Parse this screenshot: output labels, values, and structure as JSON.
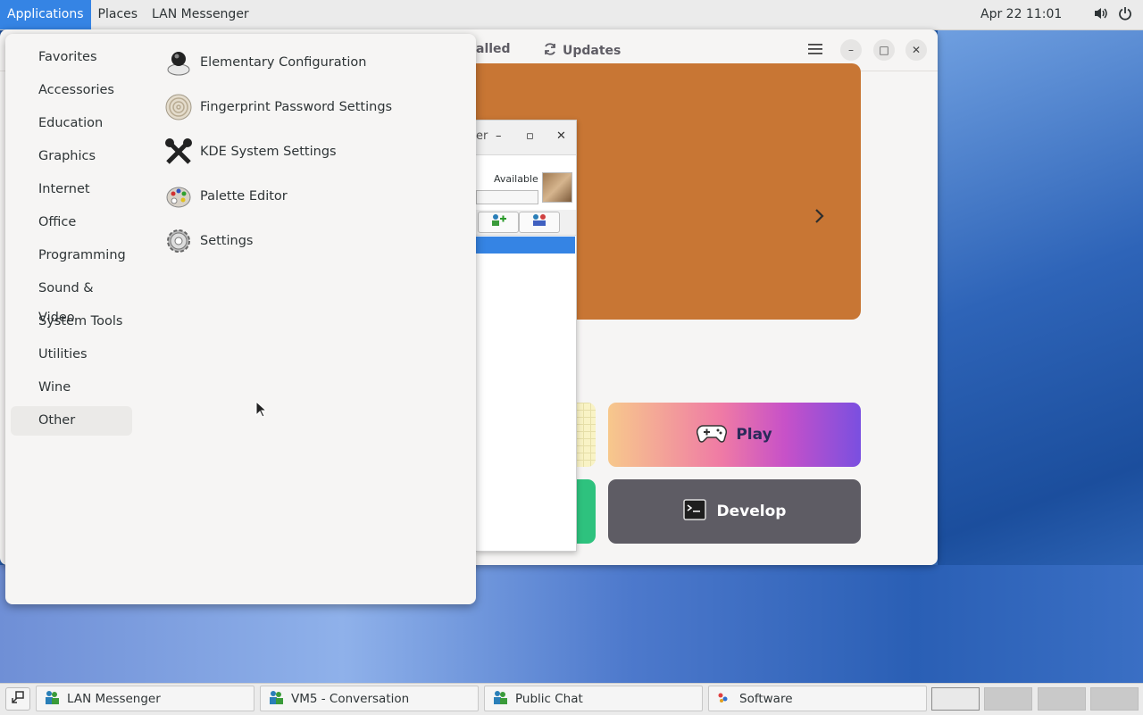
{
  "topbar": {
    "applications": "Applications",
    "places": "Places",
    "lan_messenger": "LAN Messenger",
    "clock": "Apr 22  11:01",
    "volume_icon": "volume-icon",
    "power_icon": "power-icon"
  },
  "software_window": {
    "tab_installed": "alled",
    "tab_updates": "Updates",
    "play_label": "Play",
    "develop_label": "Develop",
    "banner_color": "#c87634"
  },
  "lan_window": {
    "title_fragment": "er",
    "status": "Available"
  },
  "menu": {
    "categories": [
      "Favorites",
      "Accessories",
      "Education",
      "Graphics",
      "Internet",
      "Office",
      "Programming",
      "Sound & Video",
      "System Tools",
      "Utilities",
      "Wine",
      "Other"
    ],
    "selected_category": "Other",
    "apps": [
      "Elementary Configuration",
      "Fingerprint Password Settings",
      "KDE System Settings",
      "Palette Editor",
      "Settings"
    ]
  },
  "taskbar": {
    "tasks": [
      "LAN Messenger",
      "VM5 - Conversation",
      "Public Chat",
      "Software"
    ]
  },
  "colors": {
    "accent": "#3584e4"
  }
}
